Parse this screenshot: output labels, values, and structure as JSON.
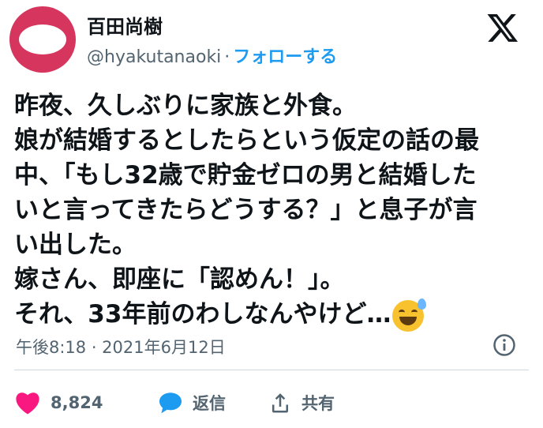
{
  "author": {
    "name": "百田尚樹",
    "handle": "@hyakutanaoki",
    "separator": "·",
    "follow_label": "フォローする"
  },
  "brand": {
    "icon": "x-logo-icon",
    "accent": "#1d9bf0",
    "avatar_color": "#d6365e"
  },
  "tweet": {
    "lines": [
      "昨夜、久しぶりに家族と外食。",
      "娘が結婚するとしたらという仮定の話の最",
      "中、「もし32歳で貯金ゼロの男と結婚した",
      "いと言ってきたらどうする？」と息子が言",
      "い出した。",
      "嫁さん、即座に「認めん！」。",
      "それ、33年前のわしなんやけど…"
    ],
    "emoji": "grinning-face-with-sweat-icon"
  },
  "meta": {
    "timestamp": "午後8:18 · 2021年6月12日"
  },
  "actions": {
    "like_count": "8,824",
    "reply_label": "返信",
    "share_label": "共有",
    "like_color": "#f91880"
  }
}
